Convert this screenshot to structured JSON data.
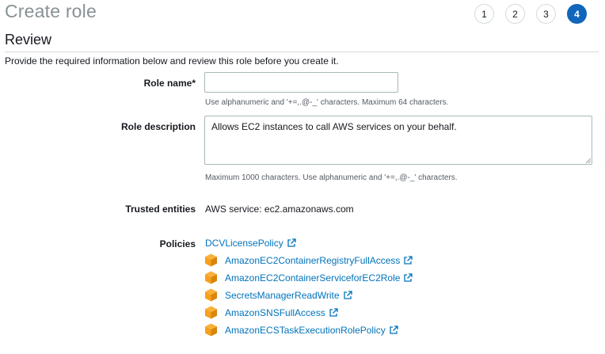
{
  "header": {
    "title": "Create role",
    "steps": [
      "1",
      "2",
      "3",
      "4"
    ],
    "active_step": "4"
  },
  "review": {
    "title": "Review",
    "intro": "Provide the required information below and review this role before you create it."
  },
  "role_name": {
    "label": "Role name*",
    "value": "",
    "hint": "Use alphanumeric and '+=,.@-_' characters. Maximum 64 characters."
  },
  "role_description": {
    "label": "Role description",
    "value": "Allows EC2 instances to call AWS services on your behalf.",
    "hint": "Maximum 1000 characters. Use alphanumeric and '+=,.@-_' characters."
  },
  "trusted_entities": {
    "label": "Trusted entities",
    "value": "AWS service: ec2.amazonaws.com"
  },
  "policies": {
    "label": "Policies",
    "items": [
      {
        "name": "DCVLicensePolicy",
        "icon": "none"
      },
      {
        "name": "AmazonEC2ContainerRegistryFullAccess",
        "icon": "aws-managed-policy-cube-icon"
      },
      {
        "name": "AmazonEC2ContainerServiceforEC2Role",
        "icon": "aws-managed-policy-cube-icon"
      },
      {
        "name": "SecretsManagerReadWrite",
        "icon": "aws-managed-policy-cube-icon"
      },
      {
        "name": "AmazonSNSFullAccess",
        "icon": "aws-managed-policy-cube-icon"
      },
      {
        "name": "AmazonECSTaskExecutionRolePolicy",
        "icon": "aws-managed-policy-cube-icon"
      }
    ]
  },
  "colors": {
    "link": "#0073bb",
    "active_step": "#1166bb",
    "cube": "#f7a01c"
  }
}
